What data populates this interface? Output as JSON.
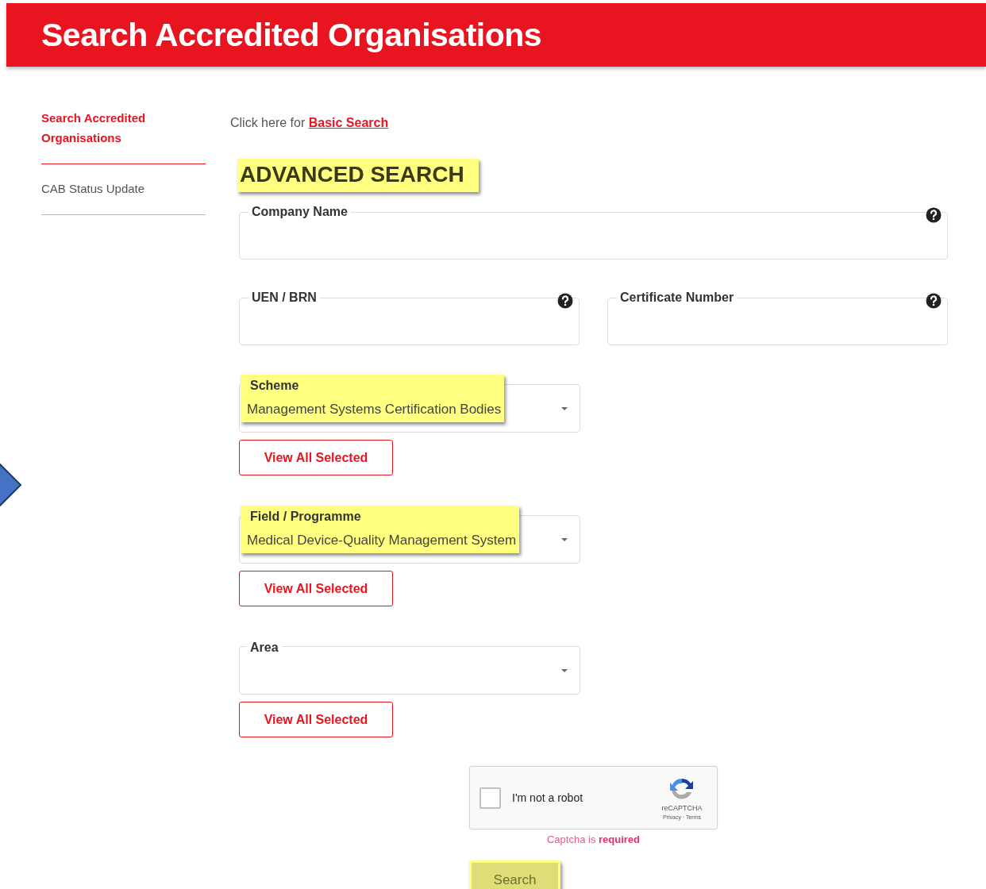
{
  "header": {
    "title": "Search Accredited Organisations"
  },
  "sidebar": {
    "items": [
      {
        "label": "Search Accredited Organisations",
        "selected": true
      },
      {
        "label": "CAB Status Update",
        "selected": false
      }
    ]
  },
  "basic_search": {
    "text": "Click here for",
    "link": "Basic Search"
  },
  "heading": {
    "text": "ADVANCED SEARCH",
    "highlighted": true
  },
  "text_field_rows": [
    [
      {
        "label": "Company Name"
      }
    ],
    [
      {
        "label": "UEN / BRN"
      },
      {
        "label": "Certificate Number"
      }
    ]
  ],
  "filters": [
    {
      "label": "Scheme",
      "value": "Management Systems Certification Bodies",
      "highlighted": true,
      "button": "View All Selected"
    },
    {
      "label": "Field / Programme",
      "value": "Medical Device-Quality Management System",
      "highlighted": true,
      "button": "View All Selected"
    },
    {
      "label": "Area",
      "button": "View All Selected"
    }
  ],
  "captcha": {
    "label": "I'm not a robot",
    "checked": false,
    "brand": "reCAPTCHA",
    "links": "Privacy · Terms",
    "message": "Captcha is **required**"
  },
  "search_button": {
    "label": "Search",
    "disabled": true,
    "highlighted": true
  },
  "pointer_arrow": {
    "shown": true
  }
}
